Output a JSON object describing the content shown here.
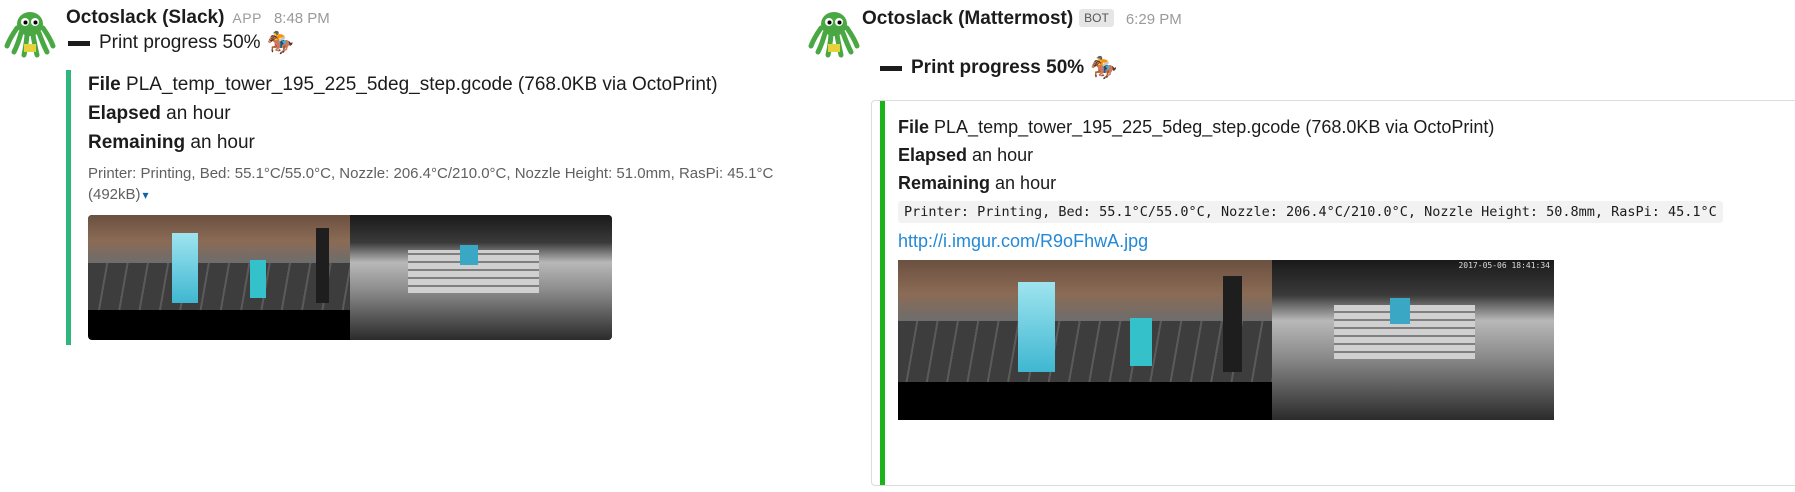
{
  "slack": {
    "sender": "Octoslack (Slack)",
    "app_tag": "APP",
    "time": "8:48 PM",
    "progress": "Print progress 50%",
    "file_label": "File",
    "file_value": "PLA_temp_tower_195_225_5deg_step.gcode (768.0KB via OctoPrint)",
    "elapsed_label": "Elapsed",
    "elapsed_value": "an hour",
    "remaining_label": "Remaining",
    "remaining_value": "an hour",
    "footer": "Printer: Printing, Bed: 55.1°C/55.0°C, Nozzle: 206.4°C/210.0°C, Nozzle Height: 51.0mm, RasPi: 45.1°C",
    "size": "(492kB)",
    "caret": "▾",
    "accent": "#2eb67d"
  },
  "mattermost": {
    "sender": "Octoslack (Mattermost)",
    "bot_tag": "BOT",
    "time": "6:29 PM",
    "progress": "Print progress 50%",
    "file_label": "File",
    "file_value": "PLA_temp_tower_195_225_5deg_step.gcode (768.0KB via OctoPrint)",
    "elapsed_label": "Elapsed",
    "elapsed_value": "an hour",
    "remaining_label": "Remaining",
    "remaining_value": "an hour",
    "status_code": "Printer: Printing, Bed: 55.1°C/55.0°C, Nozzle: 206.4°C/210.0°C, Nozzle Height: 50.8mm, RasPi: 45.1°C",
    "link": "http://i.imgur.com/R9oFhwA.jpg",
    "cam_timestamp": "2017-05-06 18:41:34",
    "accent": "#1cb21c"
  },
  "icons": {
    "avatar": "octopus-avatar-icon",
    "progress_dash": "heavy-minus-icon",
    "progress_emoji": "horse-racing-icon",
    "horse_glyph": "🏇"
  }
}
